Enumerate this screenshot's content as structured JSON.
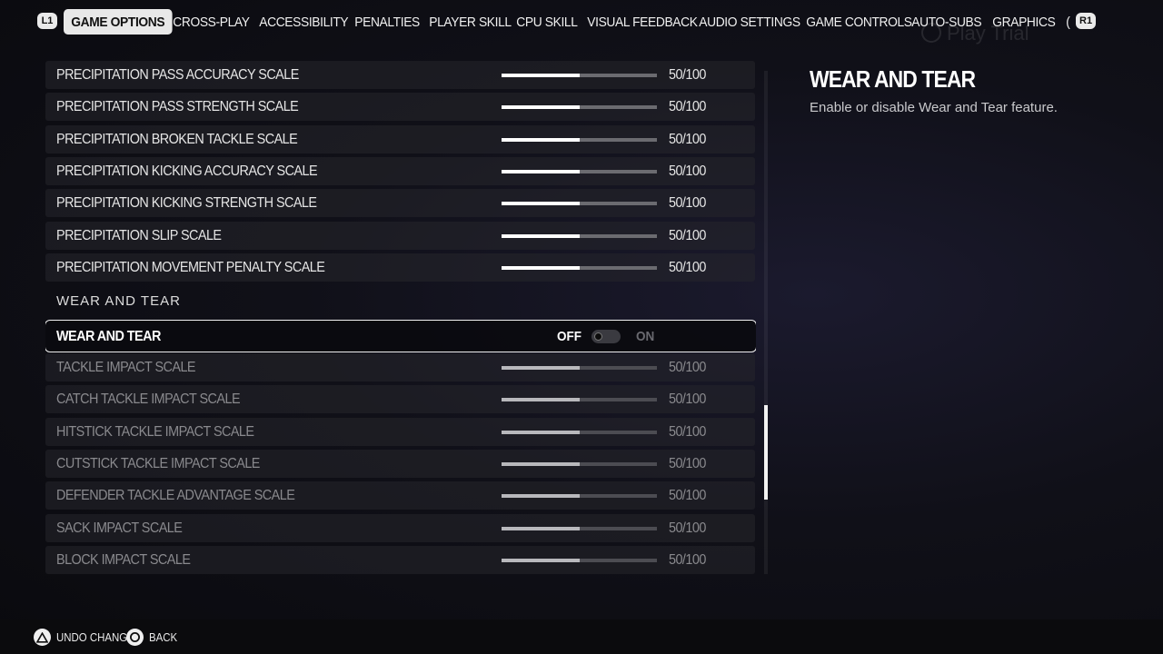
{
  "nav": {
    "left_shoulder": "L1",
    "right_shoulder": "R1",
    "tabs": [
      {
        "label": "GAME OPTIONS"
      },
      {
        "label": "CROSS-PLAY"
      },
      {
        "label": "ACCESSIBILITY"
      },
      {
        "label": "PENALTIES"
      },
      {
        "label": "PLAYER SKILL"
      },
      {
        "label": "CPU SKILL"
      },
      {
        "label": "VISUAL FEEDBACK"
      },
      {
        "label": "AUDIO SETTINGS"
      },
      {
        "label": "GAME CONTROLS"
      },
      {
        "label": "AUTO-SUBS"
      },
      {
        "label": "GRAPHICS"
      },
      {
        "label": "("
      }
    ],
    "active_tab": "GAME OPTIONS"
  },
  "watermark": "Play Trial",
  "settings": {
    "precipitation_rows": [
      {
        "label": "Precipitation Pass Accuracy Scale",
        "value": "50/100",
        "level": 0.5
      },
      {
        "label": "Precipitation Pass Strength Scale",
        "value": "50/100",
        "level": 0.5
      },
      {
        "label": "Precipitation Broken Tackle Scale",
        "value": "50/100",
        "level": 0.5
      },
      {
        "label": "Precipitation Kicking Accuracy Scale",
        "value": "50/100",
        "level": 0.5
      },
      {
        "label": "Precipitation Kicking Strength Scale",
        "value": "50/100",
        "level": 0.5
      },
      {
        "label": "Precipitation Slip Scale",
        "value": "50/100",
        "level": 0.5
      },
      {
        "label": "Precipitation Movement Penalty Scale",
        "value": "50/100",
        "level": 0.5
      }
    ],
    "section_heading": "WEAR AND TEAR",
    "toggle_row": {
      "label": "WEAR AND TEAR",
      "off_label": "OFF",
      "on_label": "ON",
      "state": "off"
    },
    "wear_rows": [
      {
        "label": "Tackle Impact Scale",
        "value": "50/100",
        "level": 0.5
      },
      {
        "label": "Catch Tackle Impact Scale",
        "value": "50/100",
        "level": 0.5
      },
      {
        "label": "Hitstick Tackle Impact Scale",
        "value": "50/100",
        "level": 0.5
      },
      {
        "label": "Cutstick Tackle Impact Scale",
        "value": "50/100",
        "level": 0.5
      },
      {
        "label": "Defender Tackle Advantage Scale",
        "value": "50/100",
        "level": 0.5
      },
      {
        "label": "Sack Impact Scale",
        "value": "50/100",
        "level": 0.5
      },
      {
        "label": "Block Impact Scale",
        "value": "50/100",
        "level": 0.5
      }
    ]
  },
  "detail": {
    "title": "WEAR AND TEAR",
    "description": "Enable or disable Wear and Tear feature."
  },
  "footer": {
    "hints": [
      {
        "icon": "triangle-button-icon",
        "label": "UNDO CHANGES"
      },
      {
        "icon": "circle-button-icon",
        "label": "BACK"
      }
    ]
  }
}
